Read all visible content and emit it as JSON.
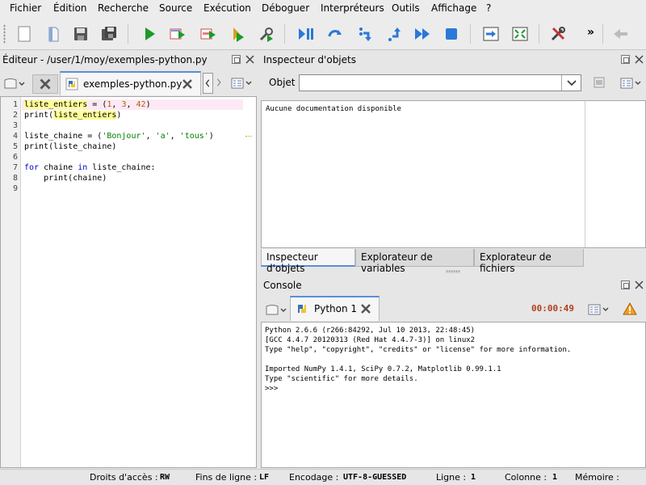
{
  "menu": [
    "Fichier",
    "Édition",
    "Recherche",
    "Source",
    "Exécution",
    "Déboguer",
    "Interpréteurs",
    "Outils",
    "Affichage",
    "?"
  ],
  "toolbar": {
    "icons": [
      "new-file-icon",
      "open-file-icon",
      "save-icon",
      "save-all-icon",
      "run-icon",
      "run-config-icon",
      "run-selection-icon",
      "debug-icon",
      "profile-icon",
      "debug-start-icon",
      "step-icon",
      "step-into-icon",
      "step-return-icon",
      "continue-icon",
      "stop-icon",
      "maximize-pane-icon",
      "fullscreen-icon",
      "tools-icon",
      "more-icon",
      "back-icon"
    ],
    "more_label": "»"
  },
  "editor": {
    "title": "Éditeur - /user/1/moy/exemples-python.py",
    "tab_label": "exemples-python.py",
    "line_numbers": [
      "1",
      "2",
      "3",
      "4",
      "5",
      "6",
      "7",
      "8",
      "9"
    ]
  },
  "inspector": {
    "title": "Inspecteur d'objets",
    "object_label": "Objet",
    "object_value": "",
    "doc_text": "Aucune documentation disponible",
    "tabs": [
      "Inspecteur d'objets",
      "Explorateur de variables",
      "Explorateur de fichiers"
    ]
  },
  "console": {
    "title": "Console",
    "tab_label": "Python 1",
    "timer": "00:00:49",
    "lines": [
      "Python 2.6.6 (r266:84292, Jul 10 2013, 22:48:45)",
      "[GCC 4.4.7 20120313 (Red Hat 4.4.7-3)] on linux2",
      "Type \"help\", \"copyright\", \"credits\" or \"license\" for more information.",
      "",
      "Imported NumPy 1.4.1, SciPy 0.7.2, Matplotlib 0.99.1.1",
      "Type \"scientific\" for more details.",
      ">>>"
    ]
  },
  "status": {
    "access_label": "Droits d'accès :",
    "access_value": "RW",
    "eol_label": "Fins de ligne :",
    "eol_value": "LF",
    "encoding_label": "Encodage :",
    "encoding_value": "UTF-8-GUESSED",
    "line_label": "Ligne :",
    "line_value": "1",
    "column_label": "Colonne :",
    "column_value": "1",
    "memory_label": "Mémoire :"
  },
  "colors": {
    "accent": "#5a8ed8",
    "keyword": "#0000c8",
    "string": "#008000",
    "number": "#b85c00",
    "timer": "#b04020"
  }
}
